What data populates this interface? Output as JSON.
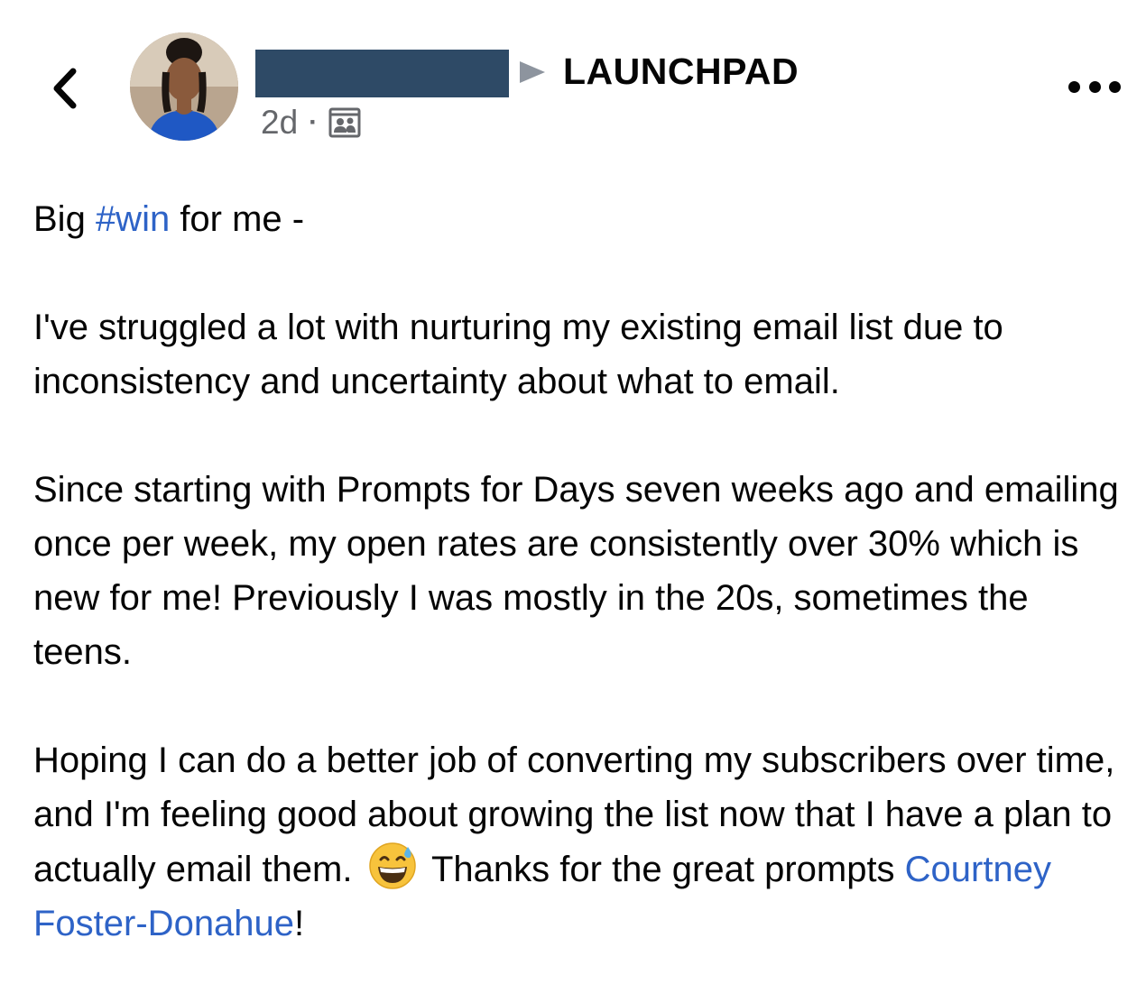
{
  "header": {
    "back_icon": "chevron-left-icon",
    "avatar_icon": "profile-photo",
    "group_arrow_icon": "triangle-right-icon",
    "group_name": "LAUNCHPAD",
    "timestamp": "2d",
    "separator": "·",
    "audience_icon": "group-members-icon",
    "more_icon": "more-dots-icon"
  },
  "post": {
    "p1_start": "Big ",
    "hashtag": "#win",
    "p1_end": " for me -",
    "p2": "I've struggled a lot with nurturing my existing email list due to inconsistency and uncertainty about what to email.",
    "p3": "Since starting with Prompts for Days seven weeks ago and emailing once per week, my open rates are consistently over 30% which is new for me! Previously I was mostly in the 20s, sometimes the teens.",
    "p4_start": "Hoping I can do a better job of converting my subscribers over time, and I'm feeling good about growing the list now that I have a plan to actually email them.",
    "emoji": "grinning-face-with-sweat-emoji",
    "p4_mid": "Thanks for the great prompts ",
    "mention": "Courtney Foster-Donahue",
    "p4_end": "!"
  },
  "colors": {
    "link": "#2e63c7",
    "redaction": "#2e4a66",
    "secondary_text": "#65676b"
  }
}
